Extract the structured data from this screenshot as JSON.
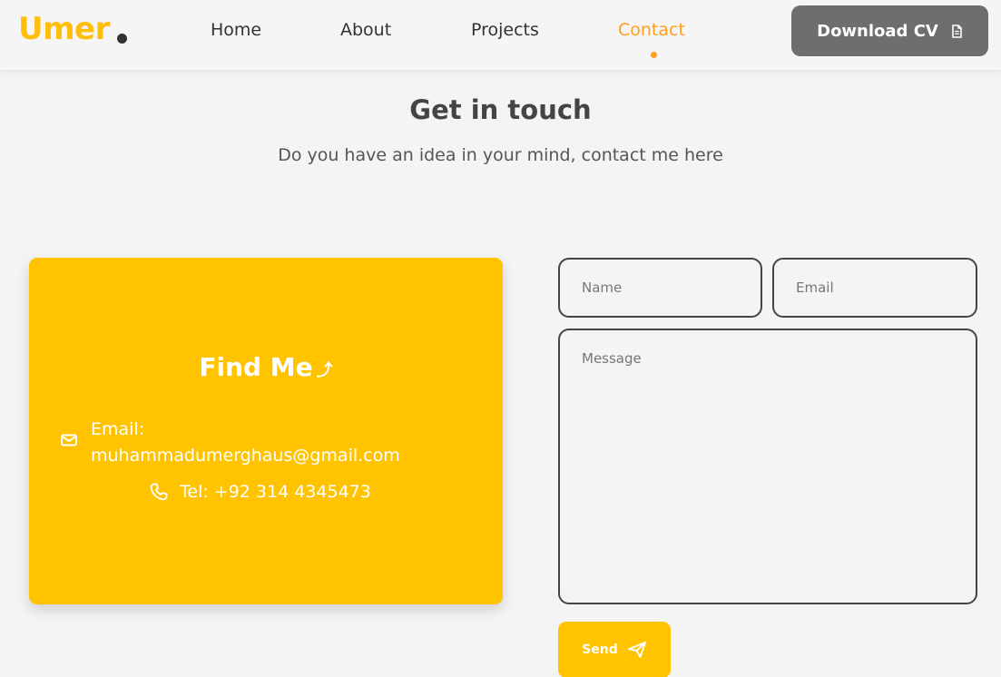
{
  "navbar": {
    "logo": "Umer",
    "links": [
      {
        "label": "Home"
      },
      {
        "label": "About"
      },
      {
        "label": "Projects"
      },
      {
        "label": "Contact",
        "active": true
      }
    ],
    "cv_button": {
      "label": "Download CV",
      "icon": "file-icon"
    }
  },
  "contact": {
    "title": "Get in touch",
    "subtitle": "Do you have an idea in your mind, contact me here"
  },
  "find_card": {
    "title": "Find Me",
    "title_icon": "arrow-down-right-icon",
    "email_label": "Email:",
    "email_value": "muhammadumerghaus@gmail.com",
    "phone": "Tel: +92 314 4345473"
  },
  "form": {
    "name_placeholder": "Name",
    "email_placeholder": "Email",
    "message_placeholder": "Message",
    "send_label": "Send",
    "send_icon": "send-icon"
  },
  "colors": {
    "brand": "#ffbe0b",
    "active_link": "#ff9f1c",
    "card": "#ffc300",
    "cv_button": "#6e6e6e",
    "background": "#f4f4f4"
  }
}
